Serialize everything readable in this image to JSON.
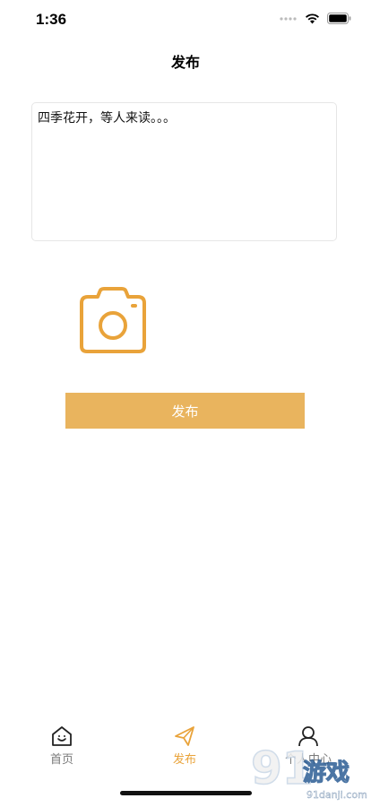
{
  "status_bar": {
    "time": "1:36"
  },
  "nav": {
    "title": "发布"
  },
  "compose": {
    "text": "四季花开，等人来读。。。"
  },
  "camera": {
    "icon": "camera-icon",
    "color": "#e9a33a"
  },
  "publish_button": {
    "label": "发布",
    "color": "#e9b45e"
  },
  "tabs": [
    {
      "label": "首页",
      "icon": "home-icon",
      "active": false
    },
    {
      "label": "发布",
      "icon": "paper-plane-icon",
      "active": true
    },
    {
      "label": "个人中心",
      "icon": "person-icon",
      "active": false
    }
  ],
  "watermark": {
    "brand": "91游戏",
    "site": "91danji.com"
  },
  "colors": {
    "accent": "#e9a33a",
    "inactive": "#7a7a7a"
  }
}
